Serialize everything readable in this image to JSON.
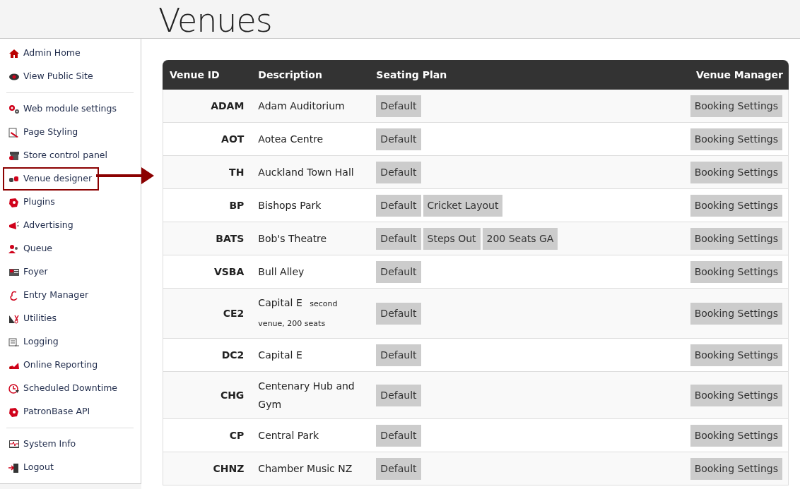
{
  "page": {
    "title": "Venues"
  },
  "sidebar": {
    "groups": [
      {
        "items": [
          {
            "label": "Admin Home",
            "selected": false
          },
          {
            "label": "View Public Site",
            "selected": false
          }
        ]
      },
      {
        "items": [
          {
            "label": "Web module settings",
            "selected": false
          },
          {
            "label": "Page Styling",
            "selected": false
          },
          {
            "label": "Store control panel",
            "selected": false
          },
          {
            "label": "Venue designer",
            "selected": true
          },
          {
            "label": "Plugins",
            "selected": false
          },
          {
            "label": "Advertising",
            "selected": false
          },
          {
            "label": "Queue",
            "selected": false
          },
          {
            "label": "Foyer",
            "selected": false
          },
          {
            "label": "Entry Manager",
            "selected": false
          },
          {
            "label": "Utilities",
            "selected": false
          },
          {
            "label": "Logging",
            "selected": false
          },
          {
            "label": "Online Reporting",
            "selected": false
          },
          {
            "label": "Scheduled Downtime",
            "selected": false
          },
          {
            "label": "PatronBase API",
            "selected": false
          }
        ]
      },
      {
        "items": [
          {
            "label": "System Info",
            "selected": false
          },
          {
            "label": "Logout",
            "selected": false
          }
        ]
      }
    ]
  },
  "table": {
    "columns": [
      "Venue ID",
      "Description",
      "Seating Plan",
      "Venue Manager"
    ],
    "rows": [
      {
        "id": "ADAM",
        "description": "Adam Auditorium",
        "plans": [
          "Default"
        ],
        "manager": "Booking Settings"
      },
      {
        "id": "AOT",
        "description": "Aotea Centre",
        "plans": [
          "Default"
        ],
        "manager": "Booking Settings"
      },
      {
        "id": "TH",
        "description": "Auckland Town Hall",
        "plans": [
          "Default"
        ],
        "manager": "Booking Settings"
      },
      {
        "id": "BP",
        "description": "Bishops Park",
        "plans": [
          "Default",
          "Cricket Layout"
        ],
        "manager": "Booking Settings"
      },
      {
        "id": "BATS",
        "description": "Bob's Theatre",
        "plans": [
          "Default",
          "Steps Out",
          "200 Seats GA"
        ],
        "manager": "Booking Settings"
      },
      {
        "id": "VSBA",
        "description": "Bull Alley",
        "plans": [
          "Default"
        ],
        "manager": "Booking Settings"
      },
      {
        "id": "CE2",
        "description": "Capital E",
        "note": "second venue, 200 seats",
        "plans": [
          "Default"
        ],
        "manager": "Booking Settings"
      },
      {
        "id": "DC2",
        "description": "Capital E",
        "plans": [
          "Default"
        ],
        "manager": "Booking Settings"
      },
      {
        "id": "CHG",
        "description": "Centenary Hub and Gym",
        "plans": [
          "Default"
        ],
        "manager": "Booking Settings"
      },
      {
        "id": "CP",
        "description": "Central Park",
        "plans": [
          "Default"
        ],
        "manager": "Booking Settings"
      },
      {
        "id": "CHNZ",
        "description": "Chamber Music NZ",
        "plans": [
          "Default"
        ],
        "manager": "Booking Settings"
      }
    ]
  }
}
